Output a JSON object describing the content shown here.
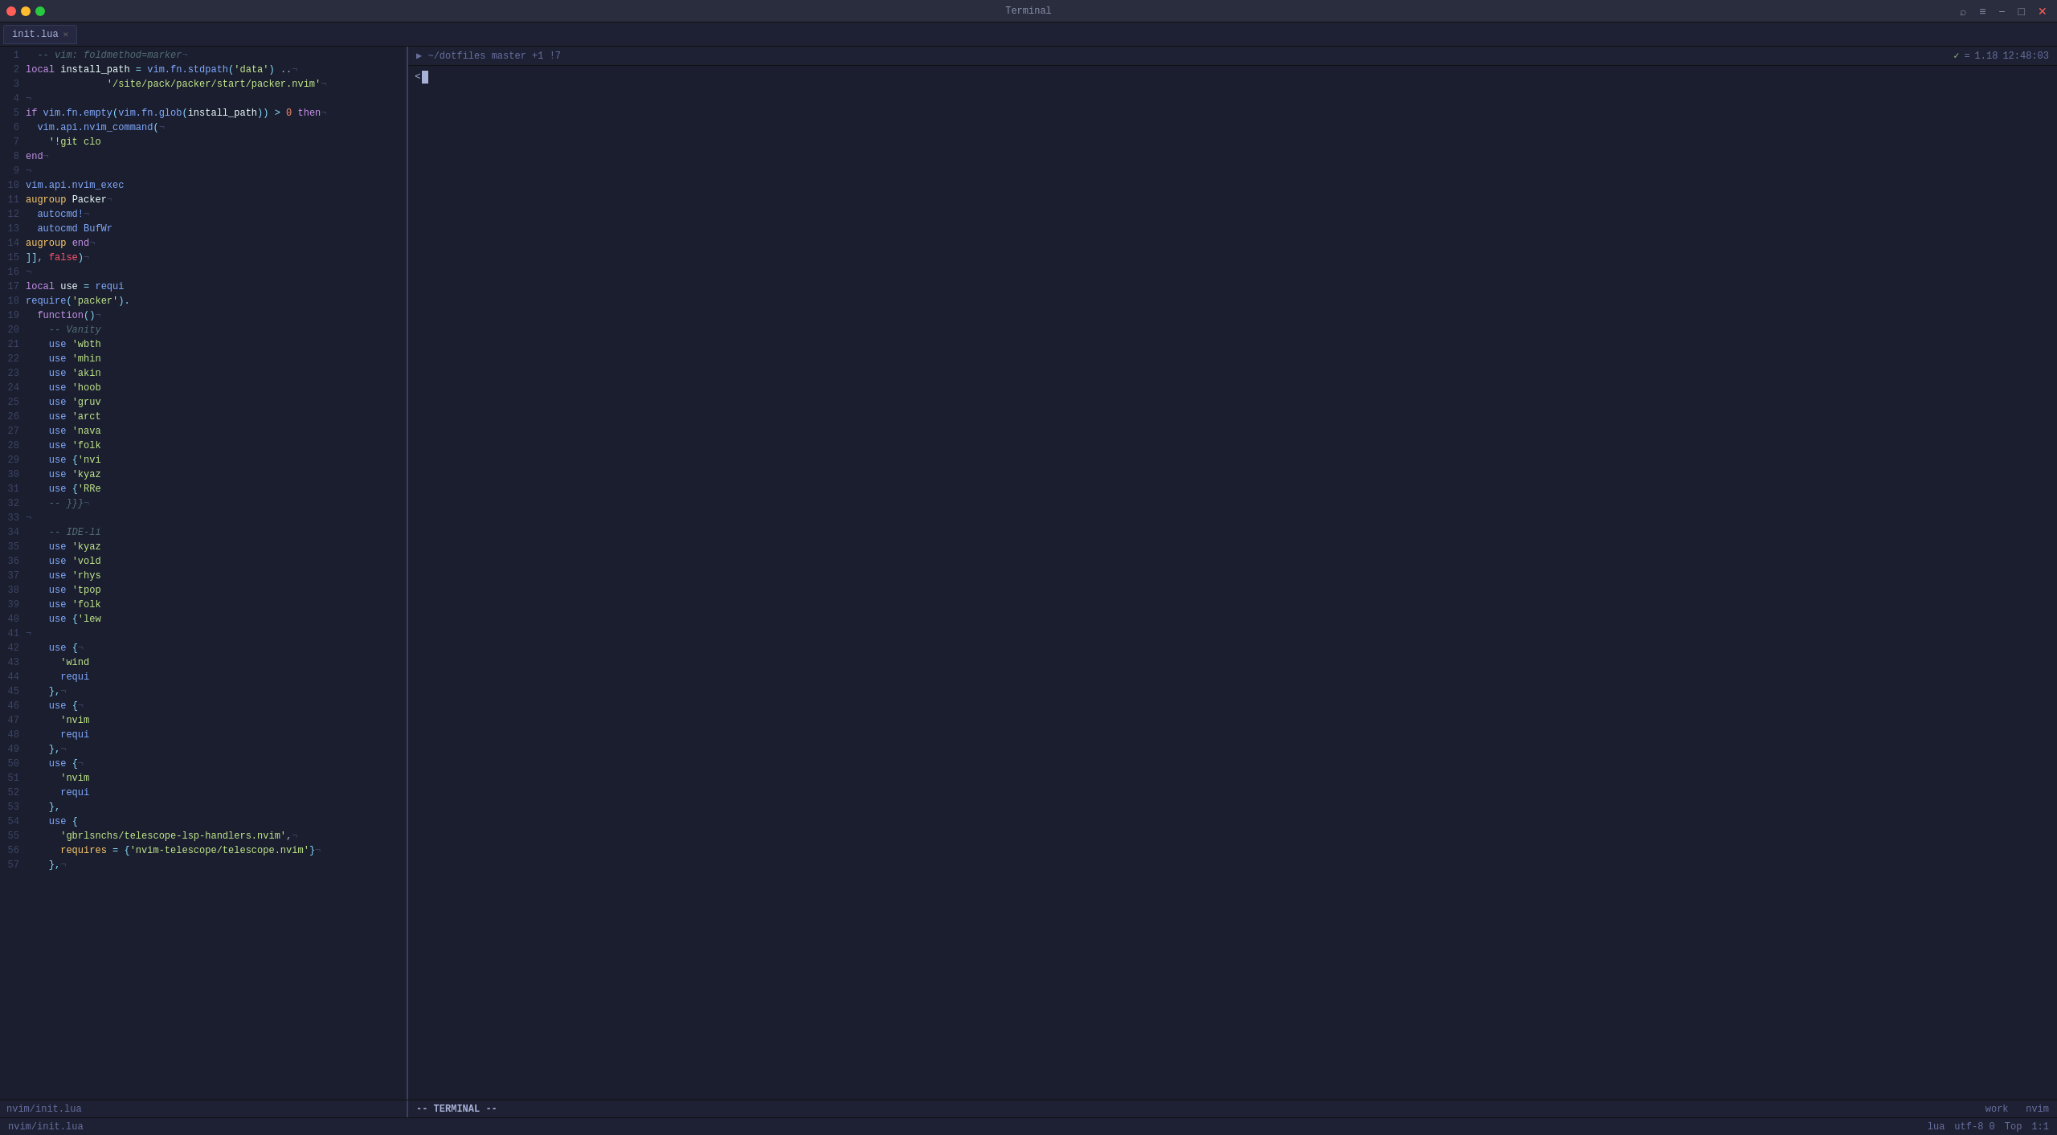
{
  "window": {
    "title": "Terminal"
  },
  "tabs": [
    {
      "label": "init.lua",
      "active": true,
      "closable": true
    }
  ],
  "editor": {
    "filename": "nvim/init.lua",
    "lines": [
      {
        "num": "1",
        "content": "  -- vim: foldmethod=marker¬",
        "type": "comment"
      },
      {
        "num": "2",
        "content": "local install_path = vim.fn.stdpath('data') ..¬",
        "type": "code"
      },
      {
        "num": "3",
        "content": "              '/site/pack/packer/start/packer.nvim'¬",
        "type": "code"
      },
      {
        "num": "4",
        "content": "¬",
        "type": "empty"
      },
      {
        "num": "5",
        "content": "if vim.fn.empty(vim.fn.glob(install_path)) > 0 then¬",
        "type": "code"
      },
      {
        "num": "6",
        "content": "  vim.api.nvim_command(¬",
        "type": "code"
      },
      {
        "num": "7",
        "content": "    '!git clo",
        "type": "code"
      },
      {
        "num": "8",
        "content": "end¬",
        "type": "code"
      },
      {
        "num": "9",
        "content": "¬",
        "type": "empty"
      },
      {
        "num": "10",
        "content": "vim.api.nvim_exec",
        "type": "code"
      },
      {
        "num": "11",
        "content": "augroup Packer¬",
        "type": "code"
      },
      {
        "num": "12",
        "content": "  autocmd!¬",
        "type": "code"
      },
      {
        "num": "13",
        "content": "  autocmd BufWr",
        "type": "code"
      },
      {
        "num": "14",
        "content": "augroup end¬",
        "type": "code"
      },
      {
        "num": "15",
        "content": "]], false)¬",
        "type": "code"
      },
      {
        "num": "16",
        "content": "¬",
        "type": "empty"
      },
      {
        "num": "17",
        "content": "local use = requi",
        "type": "code"
      },
      {
        "num": "18",
        "content": "require('packer').",
        "type": "code"
      },
      {
        "num": "19",
        "content": "  function()¬",
        "type": "code"
      },
      {
        "num": "20",
        "content": "    -- Vanity",
        "type": "comment"
      },
      {
        "num": "21",
        "content": "    use 'wbth",
        "type": "code"
      },
      {
        "num": "22",
        "content": "    use 'mhin",
        "type": "code"
      },
      {
        "num": "23",
        "content": "    use 'akin",
        "type": "code"
      },
      {
        "num": "24",
        "content": "    use 'hoob",
        "type": "code"
      },
      {
        "num": "25",
        "content": "    use 'gruv",
        "type": "code"
      },
      {
        "num": "26",
        "content": "    use 'arct",
        "type": "code"
      },
      {
        "num": "27",
        "content": "    use 'nava",
        "type": "code"
      },
      {
        "num": "28",
        "content": "    use 'folk",
        "type": "code"
      },
      {
        "num": "29",
        "content": "    use {'nvi",
        "type": "code"
      },
      {
        "num": "30",
        "content": "    use 'kyaz",
        "type": "code"
      },
      {
        "num": "31",
        "content": "    use {'RRe",
        "type": "code"
      },
      {
        "num": "32",
        "content": "    -- }}}¬",
        "type": "comment"
      },
      {
        "num": "33",
        "content": "¬",
        "type": "empty"
      },
      {
        "num": "34",
        "content": "    -- IDE-li",
        "type": "comment"
      },
      {
        "num": "35",
        "content": "    use 'kyaz",
        "type": "code"
      },
      {
        "num": "36",
        "content": "    use 'vold",
        "type": "code"
      },
      {
        "num": "37",
        "content": "    use 'rhys",
        "type": "code"
      },
      {
        "num": "38",
        "content": "    use 'tpop",
        "type": "code"
      },
      {
        "num": "39",
        "content": "    use 'folk",
        "type": "code"
      },
      {
        "num": "40",
        "content": "    use {'lew",
        "type": "code"
      },
      {
        "num": "41",
        "content": "¬",
        "type": "empty"
      },
      {
        "num": "42",
        "content": "    use {¬",
        "type": "code"
      },
      {
        "num": "43",
        "content": "      'wind",
        "type": "code"
      },
      {
        "num": "44",
        "content": "      requi",
        "type": "code"
      },
      {
        "num": "45",
        "content": "    },¬",
        "type": "code"
      },
      {
        "num": "46",
        "content": "    use {¬",
        "type": "code"
      },
      {
        "num": "47",
        "content": "      'nvim",
        "type": "code"
      },
      {
        "num": "48",
        "content": "      requi",
        "type": "code"
      },
      {
        "num": "49",
        "content": "    },¬",
        "type": "code"
      },
      {
        "num": "50",
        "content": "    use {¬",
        "type": "code"
      },
      {
        "num": "51",
        "content": "      'nvim",
        "type": "code"
      },
      {
        "num": "52",
        "content": "      requi",
        "type": "code"
      },
      {
        "num": "53",
        "content": "    },¬",
        "type": "code"
      },
      {
        "num": "54",
        "content": "    use {¬",
        "type": "code"
      },
      {
        "num": "55",
        "content": "      'gbrlsnchs/telescope-lsp-handlers.nvim',¬",
        "type": "code"
      },
      {
        "num": "56",
        "content": "      requires = {'nvim-telescope/telescope.nvim'}¬",
        "type": "code"
      },
      {
        "num": "57",
        "content": "    },¬",
        "type": "code"
      }
    ]
  },
  "terminal_statusbar": {
    "left": "▶  ~/dotfiles  master +1 !7",
    "check": "✓",
    "tilde": "=",
    "version": "1.18",
    "time": "12:48:03"
  },
  "terminal_prompt": "< ",
  "bottom_bar": {
    "editor_file": "nvim/init.lua",
    "lua_label": "lua",
    "encoding": "utf-8 0",
    "position_label": "Top",
    "line_col": "1:1",
    "terminal_mode": "-- TERMINAL --",
    "work_label": "work",
    "nvim_label": "nvim"
  }
}
